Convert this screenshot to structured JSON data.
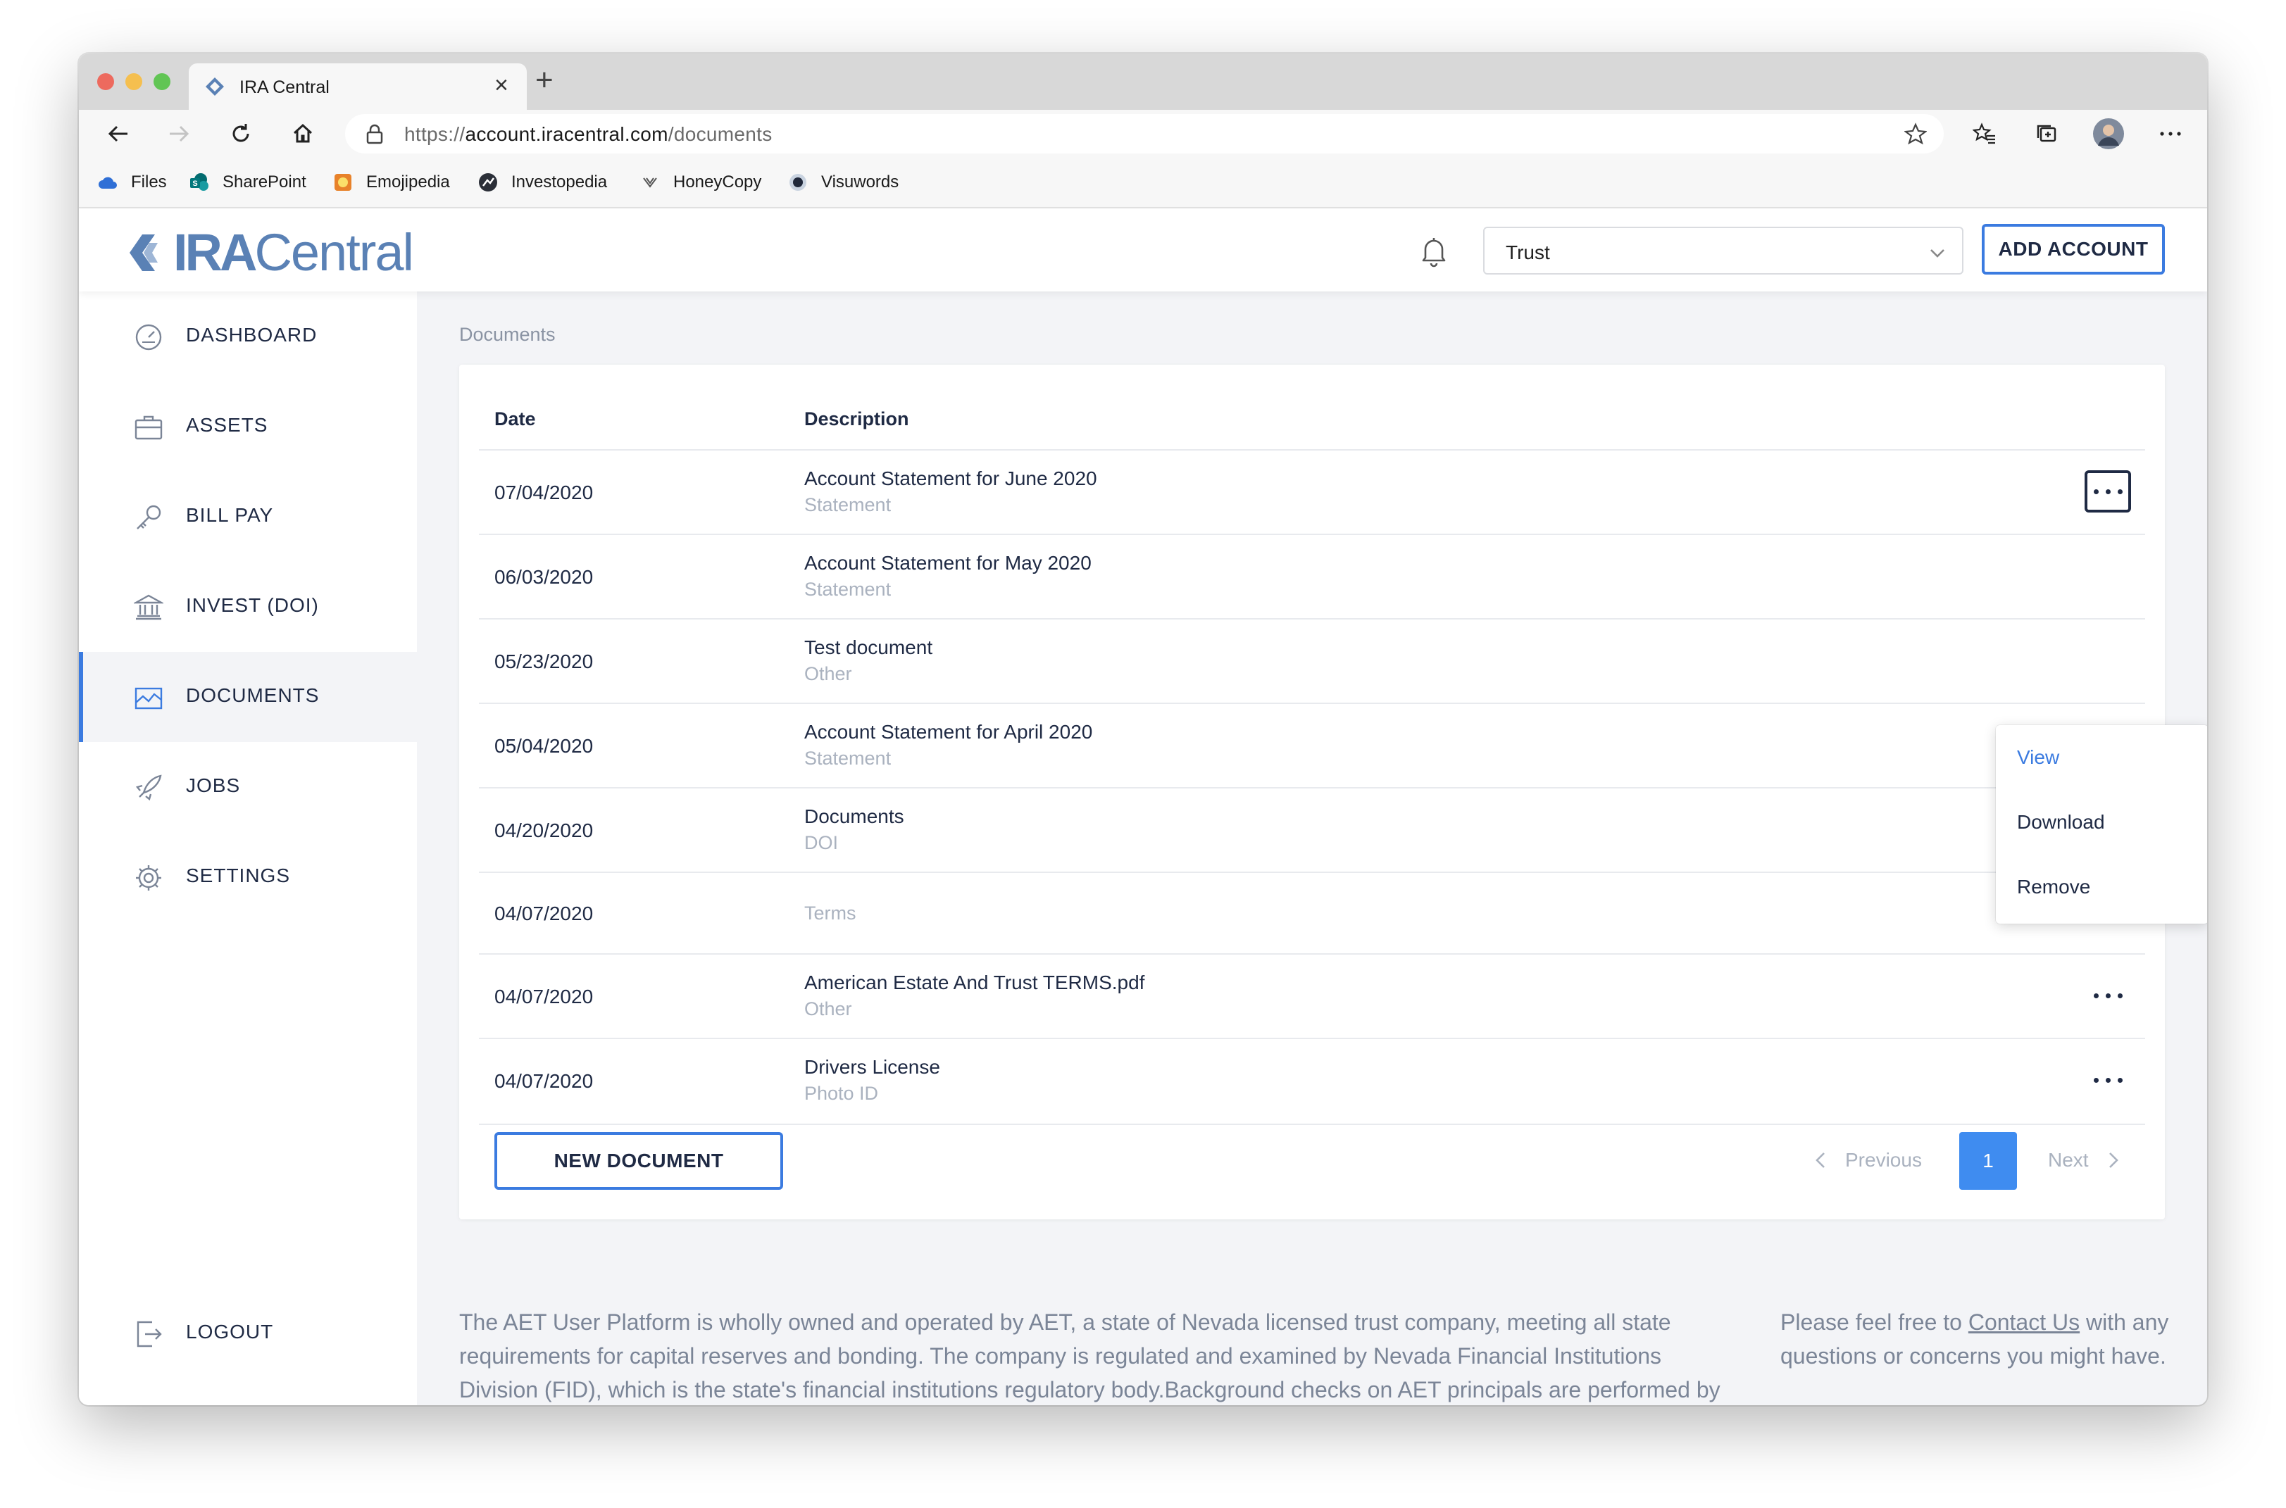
{
  "browser": {
    "tab_title": "IRA Central",
    "new_tab_symbol": "+",
    "close_symbol": "×",
    "url_scheme": "https://",
    "url_host": "account.iracentral.com",
    "url_path": "/documents",
    "bookmarks": [
      "Files",
      "SharePoint",
      "Emojipedia",
      "Investopedia",
      "HoneyCopy",
      "Visuwords"
    ]
  },
  "header": {
    "logo_bold": "IRA",
    "logo_light": "Central",
    "account_select": "Trust",
    "add_account_label": "ADD ACCOUNT"
  },
  "sidebar": {
    "items": [
      {
        "label": "DASHBOARD",
        "icon": "gauge-icon"
      },
      {
        "label": "ASSETS",
        "icon": "briefcase-icon"
      },
      {
        "label": "BILL PAY",
        "icon": "key-icon"
      },
      {
        "label": "INVEST (DOI)",
        "icon": "bank-icon"
      },
      {
        "label": "DOCUMENTS",
        "icon": "chart-icon",
        "active": true
      },
      {
        "label": "JOBS",
        "icon": "rocket-icon"
      },
      {
        "label": "SETTINGS",
        "icon": "gear-icon"
      }
    ],
    "logout_label": "LOGOUT"
  },
  "main": {
    "breadcrumb": "Documents",
    "table": {
      "headers": {
        "date": "Date",
        "description": "Description"
      },
      "rows": [
        {
          "date": "07/04/2020",
          "title": "Account Statement for June 2020",
          "type": "Statement"
        },
        {
          "date": "06/03/2020",
          "title": "Account Statement for May 2020",
          "type": "Statement"
        },
        {
          "date": "05/23/2020",
          "title": "Test document",
          "type": "Other"
        },
        {
          "date": "05/04/2020",
          "title": "Account Statement for April 2020",
          "type": "Statement"
        },
        {
          "date": "04/20/2020",
          "title": "Documents",
          "type": "DOI"
        },
        {
          "date": "04/07/2020",
          "title": "",
          "type": "Terms"
        },
        {
          "date": "04/07/2020",
          "title": "American Estate And Trust TERMS.pdf",
          "type": "Other"
        },
        {
          "date": "04/07/2020",
          "title": "Drivers License",
          "type": "Photo ID"
        }
      ]
    },
    "new_document_label": "NEW DOCUMENT",
    "pagination": {
      "previous": "Previous",
      "current": "1",
      "next": "Next"
    },
    "row_menu": {
      "view": "View",
      "download": "Download",
      "remove": "Remove"
    }
  },
  "footer": {
    "disclaimer": "The AET User Platform is wholly owned and operated by AET, a state of Nevada licensed trust company, meeting all state requirements for capital reserves and bonding. The company is regulated and examined by Nevada Financial Institutions Division (FID), which is the state's financial institutions regulatory body.Background checks on AET principals are performed by",
    "contact_prefix": "Please feel free to ",
    "contact_link": "Contact Us",
    "contact_suffix": " with any questions or concerns you might have."
  },
  "colors": {
    "accent": "#3b7be0",
    "text_primary": "#1f2a44",
    "text_muted": "#aab2bf",
    "content_bg": "#f3f4f7",
    "logo": "#5a81b5"
  }
}
